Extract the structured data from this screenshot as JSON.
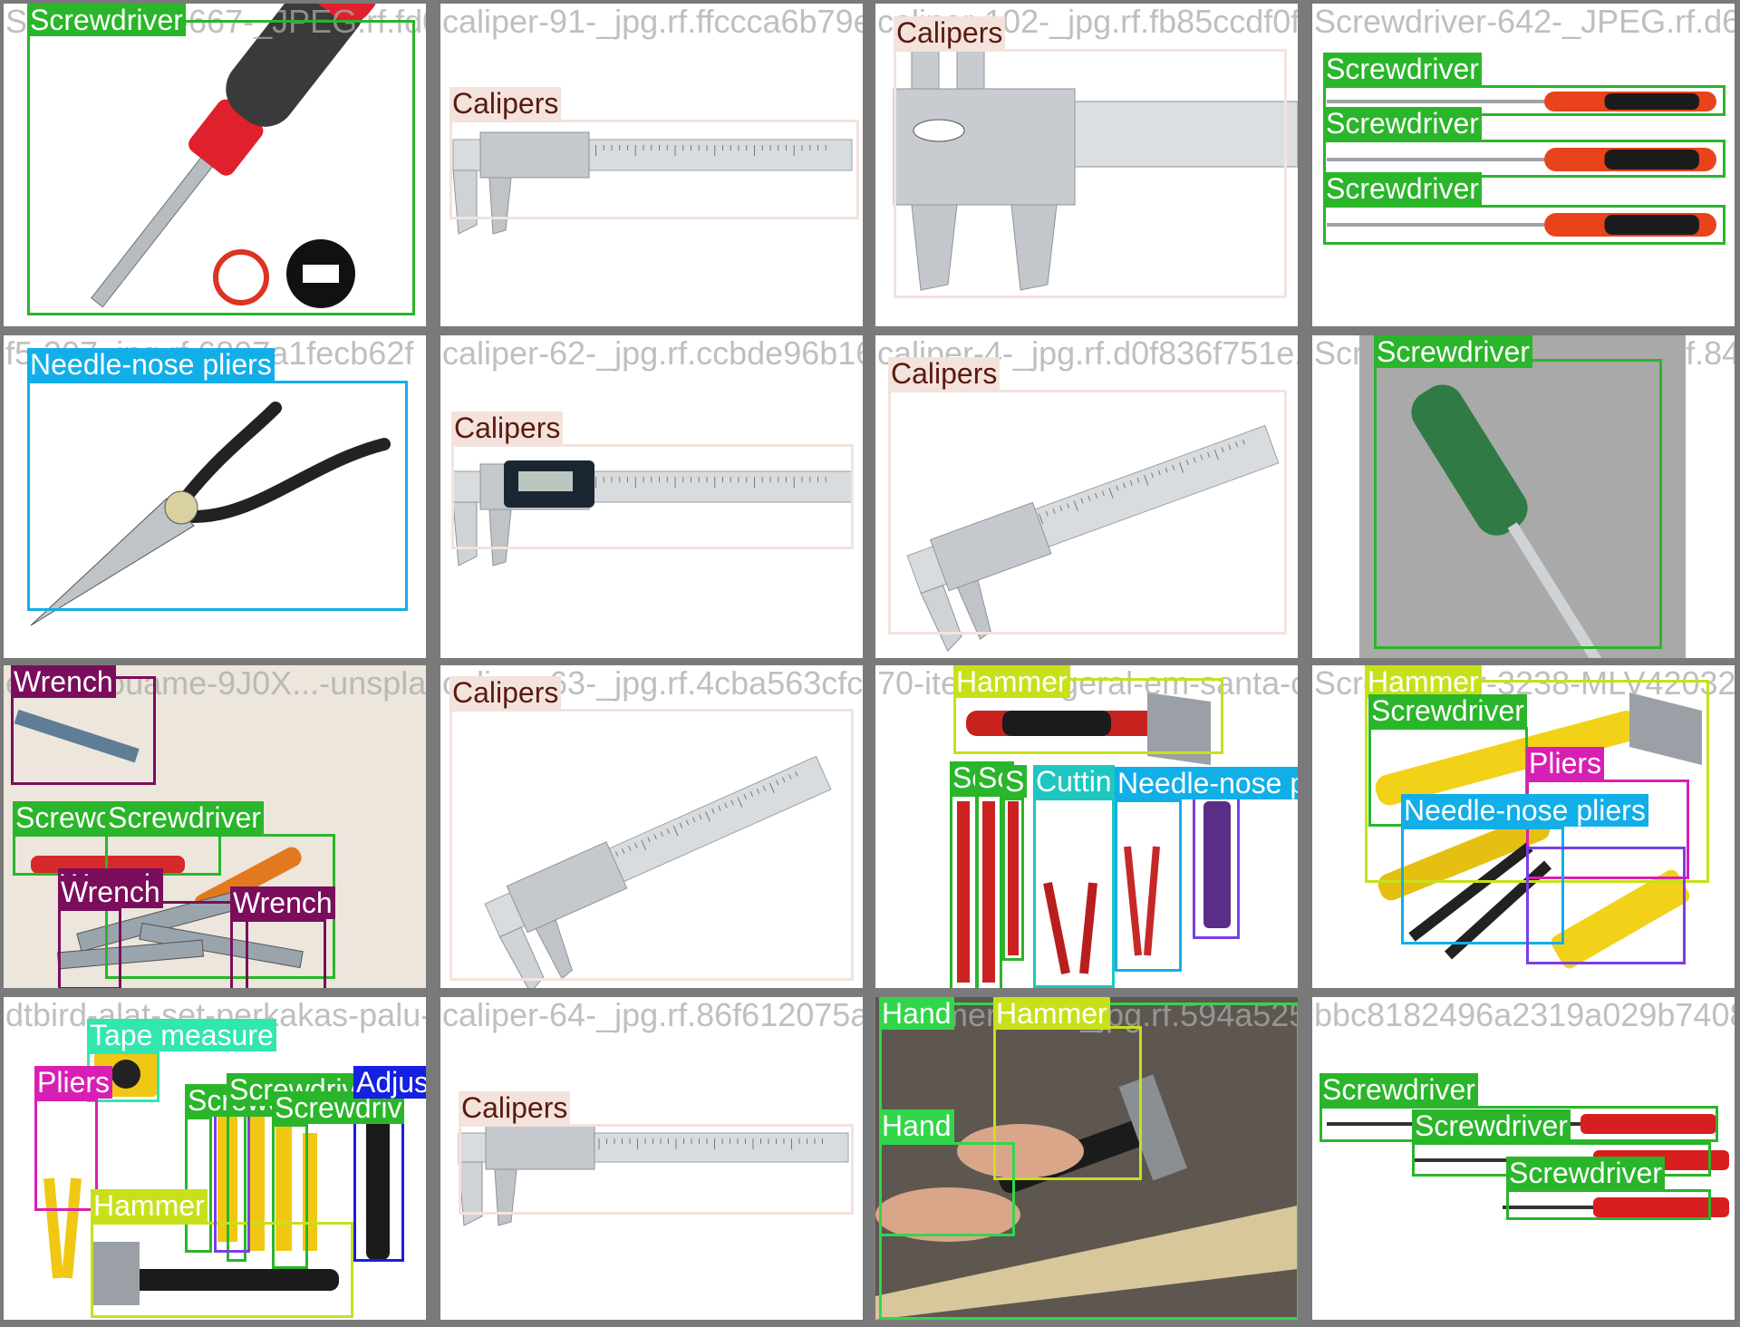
{
  "class_colors": {
    "Screwdriver": "#2ab52a",
    "Calipers": "#f3e3dc",
    "Needle-nose pliers": "#12aee8",
    "Wrench": "#7a0e5c",
    "Hammer": "#c8e01a",
    "Cutting pliers": "#1ec7c0",
    "Utility knife": "#7b3fe4",
    "Pliers": "#d81fb3",
    "Tape measure": "#32e6b0",
    "Adjustable spanner": "#1520e0",
    "Hand": "#32d64a"
  },
  "tiles": [
    {
      "filename": "Screwdriver-667-_JPEG.rf.fd09c90cb679033",
      "scene": "screwdriver",
      "detections": [
        {
          "label": "Screwdriver",
          "text": "Screwdriver"
        }
      ]
    },
    {
      "filename": "caliper-91-_jpg.rf.ffccca6b79ee6c",
      "scene": "caliper-flat",
      "detections": [
        {
          "label": "Calipers",
          "text": "Calipers"
        }
      ]
    },
    {
      "filename": "caliper-102-_jpg.rf.fb85ccdf0f224",
      "scene": "caliper-closeup",
      "detections": [
        {
          "label": "Calipers",
          "text": "Calipers"
        }
      ]
    },
    {
      "filename": "Screwdriver-642-_JPEG.rf.d6e6",
      "scene": "three-screwdrivers",
      "detections": [
        {
          "label": "Screwdriver",
          "text": "Screwdriver"
        },
        {
          "label": "Screwdriver",
          "text": "Screwdriver"
        },
        {
          "label": "Screwdriver",
          "text": "Screwdriver"
        }
      ]
    },
    {
      "filename": "f5-307_jpg.rf.6807a1fecb62f",
      "scene": "needle-nose",
      "detections": [
        {
          "label": "Needle-nose pliers",
          "text": "Needle-nose pliers"
        }
      ]
    },
    {
      "filename": "caliper-62-_jpg.rf.ccbde96b1620",
      "scene": "digital-caliper",
      "detections": [
        {
          "label": "Calipers",
          "text": "Calipers"
        }
      ]
    },
    {
      "filename": "caliper-4-_jpg.rf.d0f836f751e18",
      "scene": "caliper-diagonal",
      "detections": [
        {
          "label": "Calipers",
          "text": "Calipers"
        }
      ]
    },
    {
      "filename": "Screwdriver-625-_JPEG.rf.841b",
      "scene": "green-screwdriver",
      "detections": [
        {
          "label": "Screwdriver",
          "text": "Screwdriver"
        }
      ]
    },
    {
      "filename": "elena-rouame-9J0X...-unsplash_jpg.rf",
      "scene": "wrenches-pile",
      "detections": [
        {
          "label": "Wrench",
          "text": "Wrench"
        },
        {
          "label": "Screwdriver",
          "text": "Screwc"
        },
        {
          "label": "Screwdriver",
          "text": "Screwdriver"
        },
        {
          "label": "Wrench",
          "text": "Wrench"
        },
        {
          "label": "Wrench",
          "text": "Wrench"
        },
        {
          "label": "Wrench",
          "text": "Wrench"
        }
      ]
    },
    {
      "filename": "caliper-63-_jpg.rf.4cba563cfc47f",
      "scene": "caliper-angled",
      "detections": [
        {
          "label": "Calipers",
          "text": "Calipers"
        }
      ]
    },
    {
      "filename": "70-itens-em-geral-em-santa-cruz",
      "scene": "hammer-set",
      "detections": [
        {
          "label": "Hammer",
          "text": "Hammer"
        },
        {
          "label": "Screwdriver",
          "text": "Sc"
        },
        {
          "label": "Screwdriver",
          "text": "Sc"
        },
        {
          "label": "Screwdriver",
          "text": "S"
        },
        {
          "label": "Cutting pliers",
          "text": "Cuttin"
        },
        {
          "label": "Needle-nose pliers",
          "text": "Needle-nose pliers"
        },
        {
          "label": "Utility knife",
          "text": ""
        }
      ]
    },
    {
      "filename": "Screwdriver-3238-MLV42032",
      "scene": "yellow-toolset",
      "detections": [
        {
          "label": "Hammer",
          "text": "Hammer"
        },
        {
          "label": "Screwdriver",
          "text": "Screwdriver"
        },
        {
          "label": "Pliers",
          "text": "Pliers"
        },
        {
          "label": "Needle-nose pliers",
          "text": "Needle-nose pliers"
        },
        {
          "label": "Utility knife",
          "text": ""
        }
      ]
    },
    {
      "filename": "dtbird-alat-set-perkakas-palu-tang",
      "scene": "toolkit",
      "detections": [
        {
          "label": "Tape measure",
          "text": "Tape measure"
        },
        {
          "label": "Pliers",
          "text": "Pliers"
        },
        {
          "label": "Screwdriver",
          "text": "Screwdriver"
        },
        {
          "label": "Screwdriver",
          "text": "Screwdriver"
        },
        {
          "label": "Screwdriver",
          "text": "Screwdriv"
        },
        {
          "label": "Adjustable spanner",
          "text": "Adjustable spanner"
        },
        {
          "label": "Hammer",
          "text": "Hammer"
        },
        {
          "label": "Utility knife",
          "text": ""
        }
      ]
    },
    {
      "filename": "caliper-64-_jpg.rf.86f612075a753",
      "scene": "caliper-plain",
      "detections": [
        {
          "label": "Calipers",
          "text": "Calipers"
        }
      ]
    },
    {
      "filename": "hammer-1505_jpg.rf.594a525dbf0d8",
      "scene": "hand-hammer",
      "detections": [
        {
          "label": "Hand",
          "text": "Hand"
        },
        {
          "label": "Hammer",
          "text": "Hammer"
        },
        {
          "label": "Hand",
          "text": "Hand"
        }
      ]
    },
    {
      "filename": "bbc8182496a2319a029b74084",
      "scene": "red-screwdrivers",
      "detections": [
        {
          "label": "Screwdriver",
          "text": "Screwdriver"
        },
        {
          "label": "Screwdriver",
          "text": "Screwdriver"
        },
        {
          "label": "Screwdriver",
          "text": "Screwdriver"
        }
      ]
    }
  ]
}
